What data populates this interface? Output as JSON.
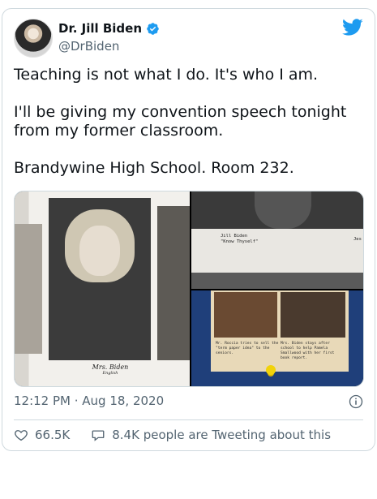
{
  "tweet": {
    "display_name": "Dr. Jill Biden",
    "handle": "@DrBiden",
    "verified": true,
    "text": "Teaching is not what I do. It's who I am.\n\nI'll be giving my convention speech tonight from my former classroom.\n\nBrandywine High School. Room 232.",
    "timestamp": "12:12 PM · Aug 18, 2020",
    "likes": "66.5K",
    "tweeting_about": "8.4K people are Tweeting about this"
  },
  "media": {
    "left": {
      "caption_name": "Mrs. Biden",
      "caption_sub": "English"
    },
    "top_right": {
      "caption_line1": "Jill Biden",
      "caption_line2": "\"Know Thyself\"",
      "caption_edge": "Jes"
    },
    "bottom_right": {
      "caption_left": "Mr. Roccia tries to sell the \"term paper idea\" to the seniors.",
      "caption_right": "Mrs. Biden stays after school to help Pamela Smallwood with her first book report."
    }
  },
  "colors": {
    "brand": "#1d9bf0",
    "text": "#0f1419",
    "muted": "#536471",
    "border": "#cfd9de"
  },
  "icons": {
    "brand": "twitter-bird-icon",
    "verified": "verified-badge-icon",
    "info": "info-icon",
    "like": "heart-icon",
    "reply": "speech-bubble-icon"
  }
}
